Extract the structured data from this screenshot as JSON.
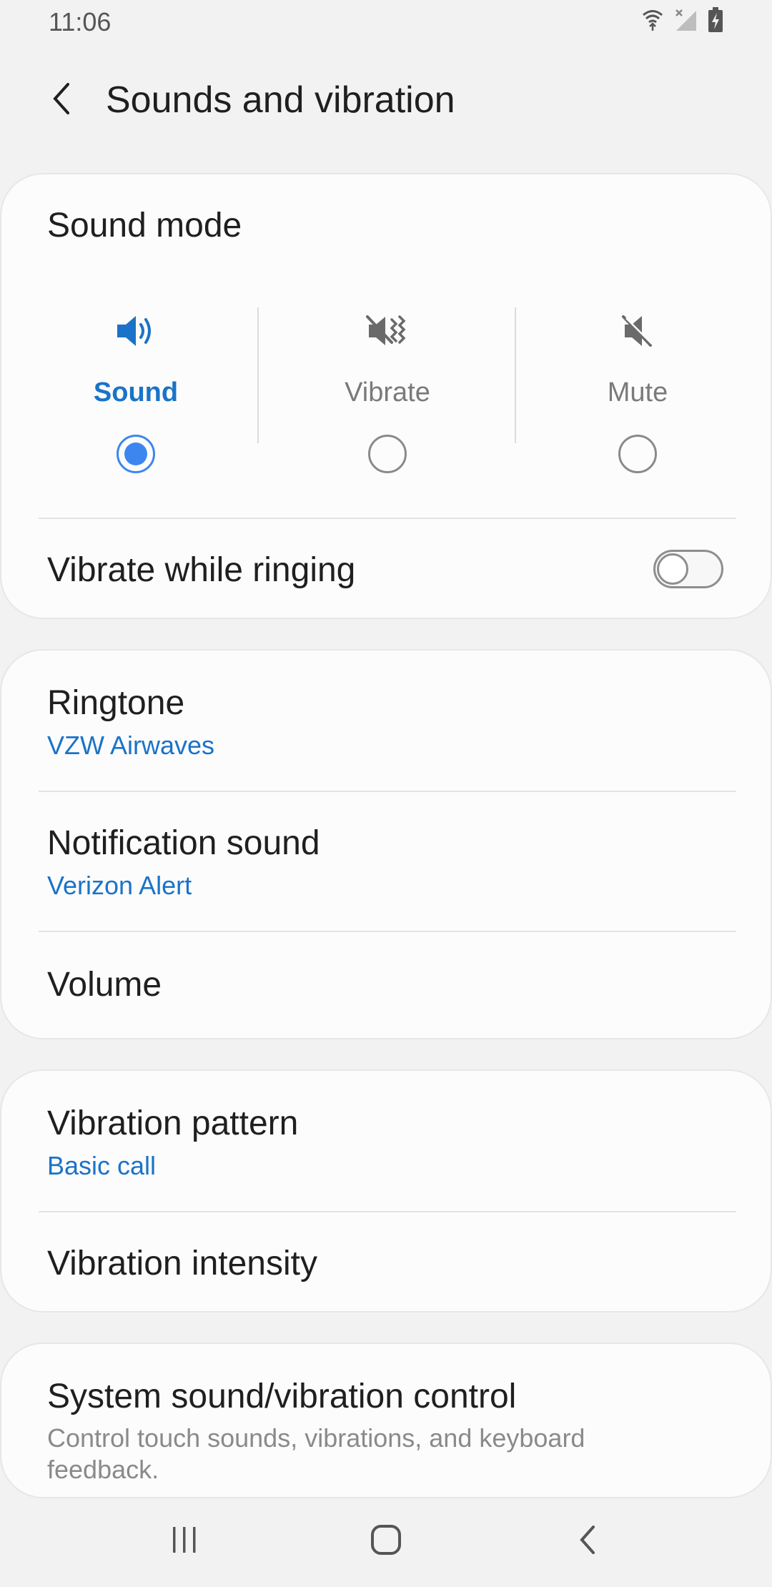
{
  "status_bar": {
    "time": "11:06"
  },
  "header": {
    "title": "Sounds and vibration"
  },
  "sound_mode": {
    "heading": "Sound mode",
    "options": [
      {
        "label": "Sound",
        "selected": true,
        "icon": "speaker-icon"
      },
      {
        "label": "Vibrate",
        "selected": false,
        "icon": "vibrate-icon"
      },
      {
        "label": "Mute",
        "selected": false,
        "icon": "mute-icon"
      }
    ],
    "accent_color": "#1a73c8",
    "vibrate_while_ringing": {
      "label": "Vibrate while ringing",
      "enabled": false
    }
  },
  "tones": {
    "ringtone": {
      "title": "Ringtone",
      "value": "VZW Airwaves"
    },
    "notification": {
      "title": "Notification sound",
      "value": "Verizon Alert"
    },
    "volume": {
      "title": "Volume"
    }
  },
  "vibration": {
    "pattern": {
      "title": "Vibration pattern",
      "value": "Basic call"
    },
    "intensity": {
      "title": "Vibration intensity"
    }
  },
  "system": {
    "title": "System sound/vibration control",
    "description": "Control touch sounds, vibrations, and keyboard feedback."
  },
  "nav_bar": {
    "buttons": [
      "recent-apps-icon",
      "home-icon",
      "back-icon"
    ]
  }
}
